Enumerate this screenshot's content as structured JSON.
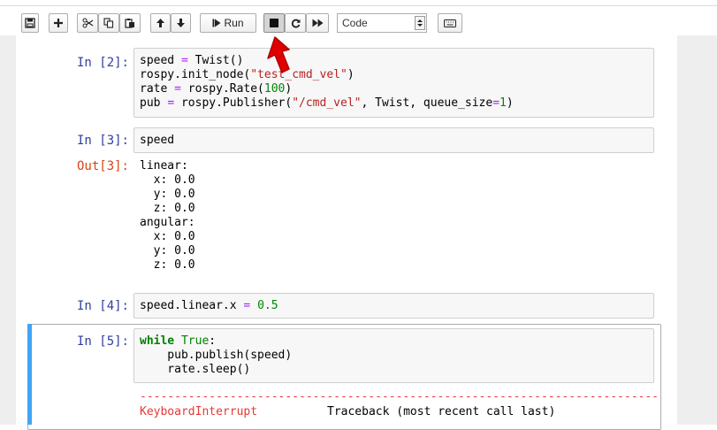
{
  "toolbar": {
    "run_label": "Run",
    "cell_type_selected": "Code",
    "icons": [
      "save-icon",
      "plus-icon",
      "cut-icon",
      "copy-icon",
      "paste-icon",
      "arrow-up-icon",
      "arrow-down-icon",
      "step-forward-icon",
      "stop-icon",
      "restart-icon",
      "fast-forward-icon",
      "keyboard-icon"
    ]
  },
  "cells": [
    {
      "prompt": "In [2]:",
      "code": [
        "speed = Twist()",
        "rospy.init_node(\"test_cmd_vel\")",
        "rate = rospy.Rate(100)",
        "pub = rospy.Publisher(\"/cmd_vel\", Twist, queue_size=1)"
      ]
    },
    {
      "prompt": "In [3]:",
      "code": [
        "speed"
      ],
      "out_prompt": "Out[3]:",
      "output": "linear:\n  x: 0.0\n  y: 0.0\n  z: 0.0\nangular:\n  x: 0.0\n  y: 0.0\n  z: 0.0"
    },
    {
      "prompt": "In [4]:",
      "code": [
        "speed.linear.x = 0.5"
      ]
    },
    {
      "prompt": "In [5]:",
      "code": [
        "while True:",
        "    pub.publish(speed)",
        "    rate.sleep()"
      ],
      "error_separator": "---------------------------------------------------------------------------",
      "error_name": "KeyboardInterrupt",
      "error_trace_header": "Traceback (most recent call last)"
    }
  ],
  "colors": {
    "prompt_in": "#303f9f",
    "prompt_out": "#d84315",
    "selected_cell_bar": "#42a5f5",
    "cursor_arrow": "#e00000",
    "error_text": "#e53935"
  }
}
